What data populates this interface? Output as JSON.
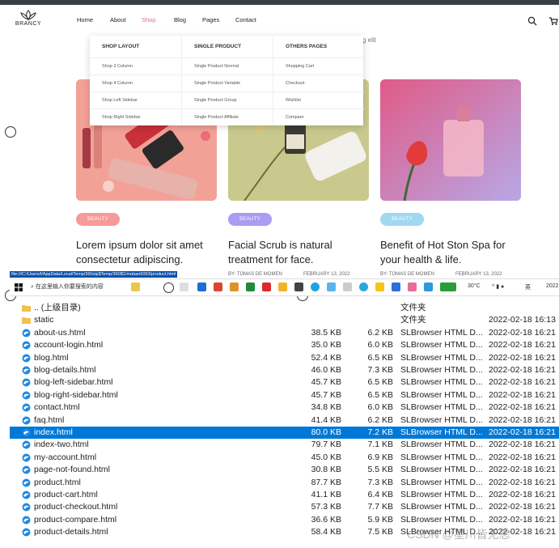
{
  "header": {
    "logo_text": "BRANCY",
    "nav": [
      {
        "label": "Home",
        "active": false
      },
      {
        "label": "About",
        "active": false
      },
      {
        "label": "Shop",
        "active": true
      },
      {
        "label": "Blog",
        "active": false
      },
      {
        "label": "Pages",
        "active": false
      },
      {
        "label": "Contact",
        "active": false
      }
    ],
    "icons": [
      "search-icon",
      "cart-icon"
    ],
    "active_color": "#e86b7a"
  },
  "hero_tail": "g elit",
  "mega_menu": {
    "columns": [
      {
        "heading": "SHOP LAYOUT",
        "items": [
          "Shop 3 Column",
          "Shop 4 Column",
          "Shop Left Sidebar",
          "Shop Right Sidebar"
        ]
      },
      {
        "heading": "SINGLE PRODUCT",
        "items": [
          "Single Product Normal",
          "Single Product Variable",
          "Single Product Group",
          "Single Product Affiliate"
        ]
      },
      {
        "heading": "OTHERS PAGES",
        "items": [
          "Shopping Cart",
          "Checkout",
          "Wishlist",
          "Compare"
        ]
      }
    ]
  },
  "cards": [
    {
      "badge": "BEAUTY",
      "badge_color": "#f79a9a",
      "title": "Lorem ipsum dolor sit amet consectetur adipiscing.",
      "author": "",
      "date": ""
    },
    {
      "badge": "BEAUTY",
      "badge_color": "#a99cf2",
      "title": "Facial Scrub is natural treatment for face.",
      "author": "BY: TOMAS DE MOMEN",
      "date": "FEBRUARY 13, 2022"
    },
    {
      "badge": "BEAUTY",
      "badge_color": "#9fd8f2",
      "title": "Benefit of Hot Ston Spa for your health & life.",
      "author": "BY: TOMAS DE MOMEN",
      "date": "FEBRUARY 13, 2022"
    }
  ],
  "status_url": "file:///C:/Users/l/AppData/Local/Temp/360zip$Temp/360$1/moban6093/product.html",
  "taskbar": {
    "search_placeholder": "在这里输入你要搜索的内容",
    "temperature": "30°C",
    "lang": "英",
    "year": "2022"
  },
  "files": [
    {
      "name": ".. (上级目录)",
      "size": "",
      "packed": "",
      "type": "文件夹",
      "date": "",
      "icon": "folder-icon"
    },
    {
      "name": "static",
      "size": "",
      "packed": "",
      "type": "文件夹",
      "date": "2022-02-18 16:13",
      "icon": "folder-icon"
    },
    {
      "name": "about-us.html",
      "size": "38.5 KB",
      "packed": "6.2 KB",
      "type": "SLBrowser HTML D...",
      "date": "2022-02-18 16:21",
      "icon": "browser-icon"
    },
    {
      "name": "account-login.html",
      "size": "35.0 KB",
      "packed": "6.0 KB",
      "type": "SLBrowser HTML D...",
      "date": "2022-02-18 16:21",
      "icon": "browser-icon"
    },
    {
      "name": "blog.html",
      "size": "52.4 KB",
      "packed": "6.5 KB",
      "type": "SLBrowser HTML D...",
      "date": "2022-02-18 16:21",
      "icon": "browser-icon"
    },
    {
      "name": "blog-details.html",
      "size": "46.0 KB",
      "packed": "7.3 KB",
      "type": "SLBrowser HTML D...",
      "date": "2022-02-18 16:21",
      "icon": "browser-icon"
    },
    {
      "name": "blog-left-sidebar.html",
      "size": "45.7 KB",
      "packed": "6.5 KB",
      "type": "SLBrowser HTML D...",
      "date": "2022-02-18 16:21",
      "icon": "browser-icon"
    },
    {
      "name": "blog-right-sidebar.html",
      "size": "45.7 KB",
      "packed": "6.5 KB",
      "type": "SLBrowser HTML D...",
      "date": "2022-02-18 16:21",
      "icon": "browser-icon"
    },
    {
      "name": "contact.html",
      "size": "34.8 KB",
      "packed": "6.0 KB",
      "type": "SLBrowser HTML D...",
      "date": "2022-02-18 16:21",
      "icon": "browser-icon"
    },
    {
      "name": "faq.html",
      "size": "41.4 KB",
      "packed": "6.2 KB",
      "type": "SLBrowser HTML D...",
      "date": "2022-02-18 16:21",
      "icon": "browser-icon"
    },
    {
      "name": "index.html",
      "size": "80.0 KB",
      "packed": "7.2 KB",
      "type": "SLBrowser HTML D...",
      "date": "2022-02-18 16:21",
      "icon": "browser-icon",
      "selected": true
    },
    {
      "name": "index-two.html",
      "size": "79.7 KB",
      "packed": "7.1 KB",
      "type": "SLBrowser HTML D...",
      "date": "2022-02-18 16:21",
      "icon": "browser-icon"
    },
    {
      "name": "my-account.html",
      "size": "45.0 KB",
      "packed": "6.9 KB",
      "type": "SLBrowser HTML D...",
      "date": "2022-02-18 16:21",
      "icon": "browser-icon"
    },
    {
      "name": "page-not-found.html",
      "size": "30.8 KB",
      "packed": "5.5 KB",
      "type": "SLBrowser HTML D...",
      "date": "2022-02-18 16:21",
      "icon": "browser-icon"
    },
    {
      "name": "product.html",
      "size": "87.7 KB",
      "packed": "7.3 KB",
      "type": "SLBrowser HTML D...",
      "date": "2022-02-18 16:21",
      "icon": "browser-icon"
    },
    {
      "name": "product-cart.html",
      "size": "41.1 KB",
      "packed": "6.4 KB",
      "type": "SLBrowser HTML D...",
      "date": "2022-02-18 16:21",
      "icon": "browser-icon"
    },
    {
      "name": "product-checkout.html",
      "size": "57.3 KB",
      "packed": "7.7 KB",
      "type": "SLBrowser HTML D...",
      "date": "2022-02-18 16:21",
      "icon": "browser-icon"
    },
    {
      "name": "product-compare.html",
      "size": "36.6 KB",
      "packed": "5.9 KB",
      "type": "SLBrowser HTML D...",
      "date": "2022-02-18 16:21",
      "icon": "browser-icon"
    },
    {
      "name": "product-details.html",
      "size": "58.4 KB",
      "packed": "7.5 KB",
      "type": "SLBrowser HTML D...",
      "date": "2022-02-18 16:21",
      "icon": "browser-icon"
    }
  ],
  "watermark": "CSDN @星川皆无恙",
  "selection_color": "#0078d7"
}
